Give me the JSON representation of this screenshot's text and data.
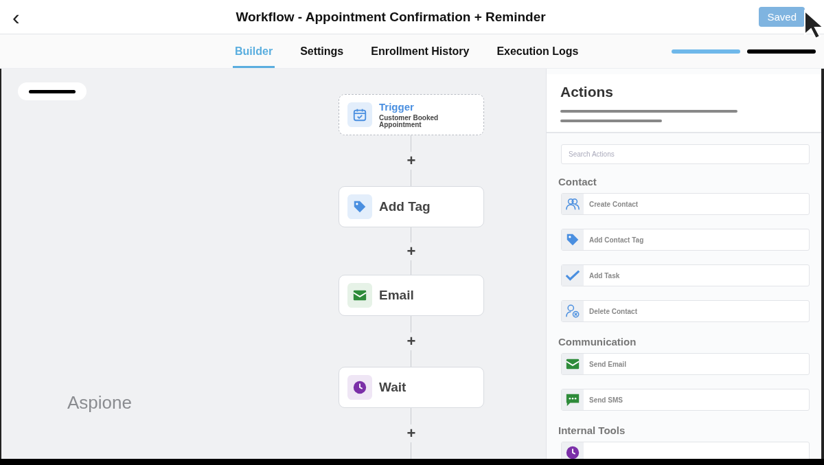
{
  "window": {
    "title": "Workflow - Appointment Confirmation + Reminder",
    "back": "‹",
    "save_button": "Saved"
  },
  "tabs": [
    {
      "label": "Builder",
      "selected": true
    },
    {
      "label": "Settings",
      "selected": false
    },
    {
      "label": "Enrollment History",
      "selected": false
    },
    {
      "label": "Execution Logs",
      "selected": false
    }
  ],
  "canvas": {
    "brand": "Aspione",
    "nodes": [
      {
        "kind": "trigger",
        "title": "Trigger",
        "subtitle": "Customer Booked Appointment"
      },
      {
        "kind": "action",
        "title": "Add Tag"
      },
      {
        "kind": "action",
        "title": "Email"
      },
      {
        "kind": "action",
        "title": "Wait"
      }
    ],
    "add_step": "+"
  },
  "actions_panel": {
    "title": "Actions",
    "search": {
      "placeholder": "Search Actions"
    },
    "sections": [
      {
        "title": "Contact",
        "items": [
          {
            "kind": "action",
            "label": "Create Contact"
          },
          {
            "kind": "action",
            "label": "Add Contact Tag"
          },
          {
            "kind": "action",
            "label": "Add Task"
          },
          {
            "kind": "action",
            "label": "Delete Contact"
          }
        ]
      },
      {
        "title": "Communication",
        "items": [
          {
            "kind": "action",
            "label": "Send Email"
          },
          {
            "kind": "action",
            "label": "Send SMS"
          }
        ]
      },
      {
        "title": "Internal Tools",
        "items": [
          {
            "kind": "cut"
          }
        ]
      }
    ]
  }
}
